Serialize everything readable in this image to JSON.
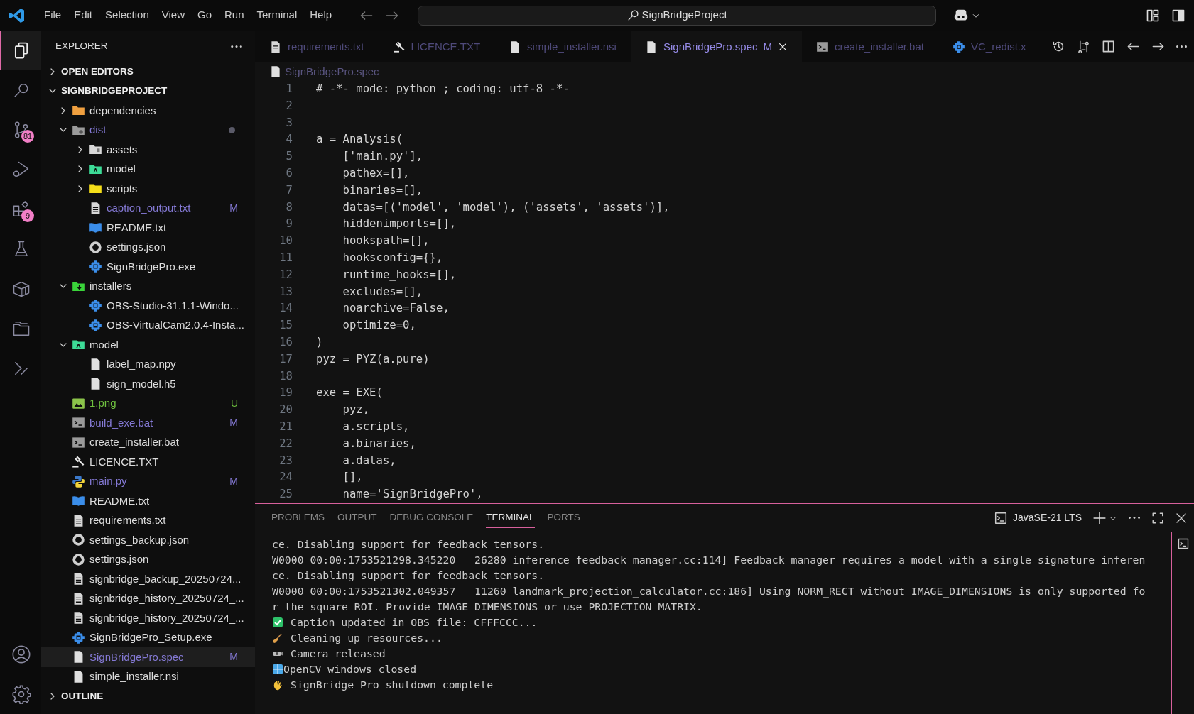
{
  "menu": [
    "File",
    "Edit",
    "Selection",
    "View",
    "Go",
    "Run",
    "Terminal",
    "Help"
  ],
  "command_center": {
    "text": "SignBridgeProject"
  },
  "activity_bar": [
    {
      "kind": "explorer",
      "selected": true
    },
    {
      "kind": "search",
      "selected": false
    },
    {
      "kind": "scm",
      "selected": false,
      "badge": "81"
    },
    {
      "kind": "debug",
      "selected": false
    },
    {
      "kind": "extensions",
      "selected": false,
      "badge": "9"
    },
    {
      "kind": "testing",
      "selected": false
    },
    {
      "kind": "box",
      "selected": false
    },
    {
      "kind": "folders",
      "selected": false
    },
    {
      "kind": "remote",
      "selected": false
    }
  ],
  "activity_bottom": [
    {
      "kind": "account",
      "selected": false
    },
    {
      "kind": "settings",
      "selected": false
    }
  ],
  "sidebar": {
    "title": "EXPLORER",
    "sections": [
      {
        "label": "OPEN EDITORS",
        "expanded": false
      },
      {
        "label": "SIGNBRIDGEPROJECT",
        "expanded": true,
        "items": [
          {
            "name": "dependencies",
            "kind": "folder",
            "expanded": false,
            "selected": false
          },
          {
            "name": "dist",
            "kind": "distfolder",
            "expanded": true,
            "selected": false,
            "color": "#8479d4",
            "dot": true,
            "children": [
              {
                "name": "assets",
                "kind": "assetsfolder",
                "expanded": false,
                "selected": false
              },
              {
                "name": "model",
                "kind": "modelfolder",
                "expanded": false,
                "selected": false
              },
              {
                "name": "scripts",
                "kind": "scriptsfolder",
                "expanded": false,
                "selected": false
              },
              {
                "name": "caption_output.txt",
                "kind": "text",
                "selected": false,
                "color": "#8479d4",
                "status": "M"
              },
              {
                "name": "README.txt",
                "kind": "readme",
                "selected": false
              },
              {
                "name": "settings.json",
                "kind": "json",
                "selected": false
              },
              {
                "name": "SignBridgePro.exe",
                "kind": "exe",
                "selected": false
              }
            ]
          },
          {
            "name": "installers",
            "kind": "installersfolder",
            "expanded": true,
            "selected": false,
            "children": [
              {
                "name": "OBS-Studio-31.1.1-Windo...",
                "kind": "exe",
                "selected": false
              },
              {
                "name": "OBS-VirtualCam2.0.4-Insta...",
                "kind": "exe",
                "selected": false
              }
            ]
          },
          {
            "name": "model",
            "kind": "modelfolder",
            "expanded": true,
            "selected": false,
            "children": [
              {
                "name": "label_map.npy",
                "kind": "file",
                "selected": false
              },
              {
                "name": "sign_model.h5",
                "kind": "file",
                "selected": false
              }
            ]
          },
          {
            "name": "1.png",
            "kind": "image",
            "selected": false,
            "color": "#6fc23f",
            "status": "U"
          },
          {
            "name": "build_exe.bat",
            "kind": "bat",
            "selected": false,
            "color": "#8479d4",
            "status": "M"
          },
          {
            "name": "create_installer.bat",
            "kind": "bat",
            "selected": false
          },
          {
            "name": "LICENCE.TXT",
            "kind": "licence",
            "selected": false
          },
          {
            "name": "main.py",
            "kind": "python",
            "selected": false,
            "color": "#8479d4",
            "status": "M"
          },
          {
            "name": "README.txt",
            "kind": "readme",
            "selected": false
          },
          {
            "name": "requirements.txt",
            "kind": "text",
            "selected": false
          },
          {
            "name": "settings_backup.json",
            "kind": "json",
            "selected": false
          },
          {
            "name": "settings.json",
            "kind": "json",
            "selected": false
          },
          {
            "name": "signbridge_backup_20250724...",
            "kind": "text",
            "selected": false
          },
          {
            "name": "signbridge_history_20250724_...",
            "kind": "text",
            "selected": false
          },
          {
            "name": "signbridge_history_20250724_...",
            "kind": "text",
            "selected": false
          },
          {
            "name": "SignBridgePro_Setup.exe",
            "kind": "exe",
            "selected": false
          },
          {
            "name": "SignBridgePro.spec",
            "kind": "file",
            "selected": true,
            "color": "#8479d4",
            "status": "M"
          },
          {
            "name": "simple_installer.nsi",
            "kind": "file",
            "selected": false
          }
        ]
      },
      {
        "label": "OUTLINE",
        "expanded": false
      }
    ]
  },
  "tabs": [
    {
      "label": "requirements.txt",
      "kind": "text",
      "selected": false
    },
    {
      "label": "LICENCE.TXT",
      "kind": "licence",
      "selected": false
    },
    {
      "label": "simple_installer.nsi",
      "kind": "file",
      "selected": false
    },
    {
      "label": "SignBridgePro.spec",
      "kind": "file",
      "selected": true,
      "status": "M"
    },
    {
      "label": "create_installer.bat",
      "kind": "bat",
      "selected": false
    },
    {
      "label": "VC_redist.x",
      "kind": "exe",
      "selected": false
    }
  ],
  "breadcrumb": {
    "label": "SignBridgePro.spec",
    "kind": "file"
  },
  "code": [
    {
      "number": "1",
      "text": "# -*- mode: python ; coding: utf-8 -*-"
    },
    {
      "number": "2"
    },
    {
      "number": "3"
    },
    {
      "number": "4",
      "text": "a = Analysis("
    },
    {
      "number": "5",
      "text": "    ['main.py'],"
    },
    {
      "number": "6",
      "text": "    pathex=[],"
    },
    {
      "number": "7",
      "text": "    binaries=[],"
    },
    {
      "number": "8",
      "text": "    datas=[('model', 'model'), ('assets', 'assets')],"
    },
    {
      "number": "9",
      "text": "    hiddenimports=[],"
    },
    {
      "number": "10",
      "text": "    hookspath=[],"
    },
    {
      "number": "11",
      "text": "    hooksconfig={},"
    },
    {
      "number": "12",
      "text": "    runtime_hooks=[],"
    },
    {
      "number": "13",
      "text": "    excludes=[],"
    },
    {
      "number": "14",
      "text": "    noarchive=False,"
    },
    {
      "number": "15",
      "text": "    optimize=0,"
    },
    {
      "number": "16",
      "text": ")"
    },
    {
      "number": "17",
      "text": "pyz = PYZ(a.pure)"
    },
    {
      "number": "18"
    },
    {
      "number": "19",
      "text": "exe = EXE("
    },
    {
      "number": "20",
      "text": "    pyz,"
    },
    {
      "number": "21",
      "text": "    a.scripts,"
    },
    {
      "number": "22",
      "text": "    a.binaries,"
    },
    {
      "number": "23",
      "text": "    a.datas,"
    },
    {
      "number": "24",
      "text": "    [],"
    },
    {
      "number": "25",
      "text": "    name='SignBridgePro',"
    }
  ],
  "panel_tabs": [
    {
      "label": "PROBLEMS",
      "selected": false
    },
    {
      "label": "OUTPUT",
      "selected": false
    },
    {
      "label": "DEBUG CONSOLE",
      "selected": false
    },
    {
      "label": "TERMINAL",
      "selected": true
    },
    {
      "label": "PORTS",
      "selected": false
    }
  ],
  "terminal_profile": "JavaSE-21 LTS",
  "terminal": [
    {
      "kind": "plain",
      "text": "ce. Disabling support for feedback tensors."
    },
    {
      "kind": "plain",
      "text": "W0000 00:00:1753521298.345220   26280 inference_feedback_manager.cc:114] Feedback manager requires a model with a single signature inferen"
    },
    {
      "kind": "plain",
      "text": "ce. Disabling support for feedback tensors."
    },
    {
      "kind": "plain",
      "text": "W0000 00:00:1753521302.049357   11260 landmark_projection_calculator.cc:186] Using NORM_RECT without IMAGE_DIMENSIONS is only supported fo"
    },
    {
      "kind": "plain",
      "text": "r the square ROI. Provide IMAGE_DIMENSIONS or use PROJECTION_MATRIX."
    },
    {
      "kind": "check",
      "text": "Caption updated in OBS file: CFFFCCC..."
    },
    {
      "kind": "broom",
      "text": "Cleaning up resources..."
    },
    {
      "kind": "camera",
      "text": "Camera released"
    },
    {
      "kind": "window",
      "text": "OpenCV windows closed"
    },
    {
      "kind": "wave",
      "text": "SignBridge Pro shutdown complete"
    }
  ]
}
